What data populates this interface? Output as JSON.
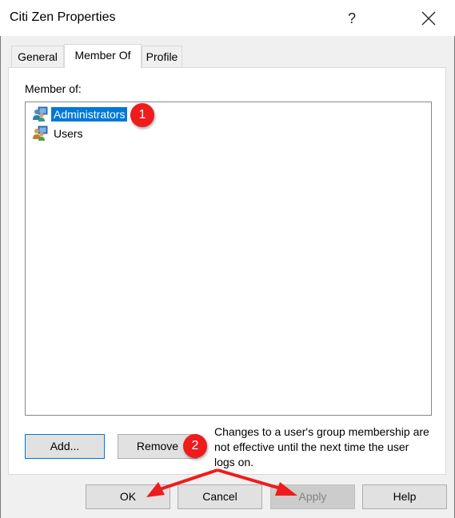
{
  "window": {
    "title": "Citi Zen Properties",
    "help_label": "?",
    "close_icon": "close-icon"
  },
  "tabs": [
    {
      "label": "General",
      "active": false
    },
    {
      "label": "Member Of",
      "active": true
    },
    {
      "label": "Profile",
      "active": false
    }
  ],
  "member_of": {
    "label": "Member of:",
    "groups": [
      {
        "name": "Administrators",
        "icon": "group-icon",
        "selected": true
      },
      {
        "name": "Users",
        "icon": "group-icon",
        "selected": false
      }
    ]
  },
  "actions": {
    "add_label": "Add...",
    "remove_label": "Remove",
    "note": "Changes to a user's group membership are not effective until the next time the user logs on."
  },
  "footer": {
    "ok_label": "OK",
    "cancel_label": "Cancel",
    "apply_label": "Apply",
    "apply_enabled": false,
    "help_label": "Help"
  },
  "annotations": {
    "badge_1": "1",
    "badge_2": "2",
    "color": "#ee1c1c"
  },
  "colors": {
    "selection": "#0078d7",
    "default_button_border": "#0078d7"
  }
}
